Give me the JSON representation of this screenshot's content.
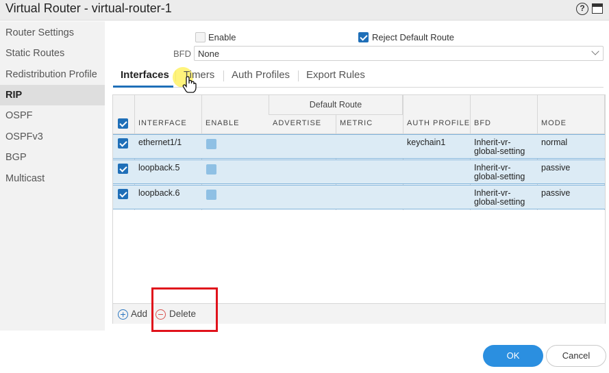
{
  "window": {
    "title": "Virtual Router - virtual-router-1",
    "help_icon": "help-icon",
    "maximize_icon": "maximize-icon"
  },
  "sidebar": {
    "items": [
      {
        "label": "Router Settings",
        "active": false
      },
      {
        "label": "Static Routes",
        "active": false
      },
      {
        "label": "Redistribution Profile",
        "active": false
      },
      {
        "label": "RIP",
        "active": true
      },
      {
        "label": "OSPF",
        "active": false
      },
      {
        "label": "OSPFv3",
        "active": false
      },
      {
        "label": "BGP",
        "active": false
      },
      {
        "label": "Multicast",
        "active": false
      }
    ]
  },
  "options": {
    "enable_label": "Enable",
    "enable_checked": false,
    "reject_default_route_label": "Reject Default Route",
    "reject_default_route_checked": true,
    "bfd_label": "BFD",
    "bfd_value": "None"
  },
  "tabs": [
    {
      "label": "Interfaces",
      "active": true
    },
    {
      "label": "Timers",
      "active": false
    },
    {
      "label": "Auth Profiles",
      "active": false
    },
    {
      "label": "Export Rules",
      "active": false
    }
  ],
  "table": {
    "group_header": "Default Route",
    "columns": [
      "INTERFACE",
      "ENABLE",
      "ADVERTISE",
      "METRIC",
      "AUTH PROFILE",
      "BFD",
      "MODE"
    ],
    "rows": [
      {
        "selected": true,
        "interface": "ethernet1/1",
        "enable": true,
        "advertise": "",
        "metric": "",
        "auth_profile": "keychain1",
        "bfd_line1": "Inherit-vr-",
        "bfd_line2": "global-setting",
        "mode": "normal"
      },
      {
        "selected": true,
        "interface": "loopback.5",
        "enable": true,
        "advertise": "",
        "metric": "",
        "auth_profile": "",
        "bfd_line1": "Inherit-vr-",
        "bfd_line2": "global-setting",
        "mode": "passive"
      },
      {
        "selected": true,
        "interface": "loopback.6",
        "enable": true,
        "advertise": "",
        "metric": "",
        "auth_profile": "",
        "bfd_line1": "Inherit-vr-",
        "bfd_line2": "global-setting",
        "mode": "passive"
      }
    ]
  },
  "footer": {
    "add_label": "Add",
    "delete_label": "Delete"
  },
  "dialog_buttons": {
    "ok_label": "OK",
    "cancel_label": "Cancel"
  },
  "colors": {
    "accent": "#2b8fe0",
    "selected_row": "#dcebf5",
    "highlight_box": "#e0121b"
  }
}
